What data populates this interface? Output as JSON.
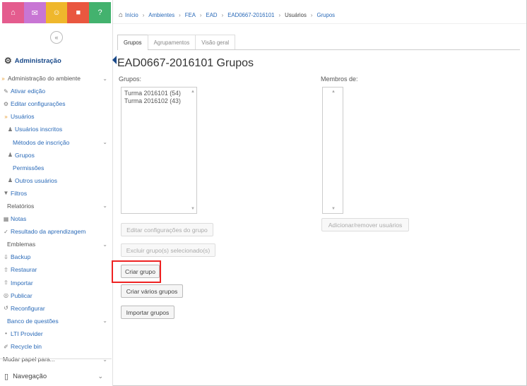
{
  "topbar": {
    "buttons": [
      {
        "icon": "home-icon",
        "glyph": "⌂",
        "color": "#e45c8e"
      },
      {
        "icon": "mail-icon",
        "glyph": "✉",
        "color": "#c876d4"
      },
      {
        "icon": "people-icon",
        "glyph": "☺",
        "color": "#efb72c"
      },
      {
        "icon": "book-icon",
        "glyph": "■",
        "color": "#e9573f"
      },
      {
        "icon": "help-icon",
        "glyph": "?",
        "color": "#43b26e"
      }
    ]
  },
  "sidebar": {
    "collapse_glyph": "«",
    "admin_title": "Administração",
    "items": [
      {
        "label": "Administração do ambiente",
        "icon": "",
        "chev": "⌄",
        "plain": true
      },
      {
        "label": "Ativar edição",
        "icon": "✎",
        "chev": ""
      },
      {
        "label": "Editar configurações",
        "icon": "⚙",
        "chev": ""
      },
      {
        "label": "Usuários",
        "icon": "»",
        "chev": "",
        "orange": true
      },
      {
        "label": "Usuários inscritos",
        "icon": "♟",
        "chev": "",
        "indent": 1
      },
      {
        "label": "Métodos de inscrição",
        "icon": "",
        "chev": "⌄",
        "indent": 2
      },
      {
        "label": "Grupos",
        "icon": "♟",
        "chev": "",
        "indent": 1
      },
      {
        "label": "Permissões",
        "icon": "",
        "chev": "",
        "indent": 2
      },
      {
        "label": "Outros usuários",
        "icon": "♟",
        "chev": "",
        "indent": 1
      },
      {
        "label": "Filtros",
        "icon": "▼",
        "chev": ""
      },
      {
        "label": "Relatórios",
        "icon": "",
        "chev": "⌄",
        "indent": 1,
        "plain": true
      },
      {
        "label": "Notas",
        "icon": "▦",
        "chev": ""
      },
      {
        "label": "Resultado da aprendizagem",
        "icon": "✓",
        "chev": ""
      },
      {
        "label": "Emblemas",
        "icon": "",
        "chev": "⌄",
        "indent": 1,
        "plain": true
      },
      {
        "label": "Backup",
        "icon": "⇩",
        "chev": ""
      },
      {
        "label": "Restaurar",
        "icon": "⇧",
        "chev": ""
      },
      {
        "label": "Importar",
        "icon": "⇧",
        "chev": ""
      },
      {
        "label": "Publicar",
        "icon": "◎",
        "chev": ""
      },
      {
        "label": "Reconfigurar",
        "icon": "↺",
        "chev": ""
      },
      {
        "label": "Banco de questões",
        "icon": "",
        "chev": "⌄",
        "indent": 1
      },
      {
        "label": "LTI Provider",
        "icon": "•",
        "chev": ""
      },
      {
        "label": "Recycle bin",
        "icon": "✐",
        "chev": ""
      },
      {
        "label": "Mudar papel para...",
        "icon": "",
        "chev": "⌄",
        "plain": true
      }
    ],
    "navegacao": "Navegação"
  },
  "breadcrumb": {
    "items": [
      "Início",
      "Ambientes",
      "FEA",
      "EAD",
      "EAD0667-2016101",
      "Usuários",
      "Grupos"
    ]
  },
  "tabs": [
    "Grupos",
    "Agrupamentos",
    "Visão geral"
  ],
  "main": {
    "title": "EAD0667-2016101 Grupos",
    "groups_label": "Grupos:",
    "members_label": "Membros de:",
    "groups": [
      "Turma 2016101 (54)",
      "Turma 2016102 (43)"
    ],
    "buttons": {
      "edit": "Editar configurações do grupo",
      "delete": "Excluir grupo(s) selecionado(s)",
      "create": "Criar grupo",
      "create_many": "Criar vários grupos",
      "import": "Importar grupos",
      "add_remove": "Adicionar/remover usuários"
    }
  }
}
